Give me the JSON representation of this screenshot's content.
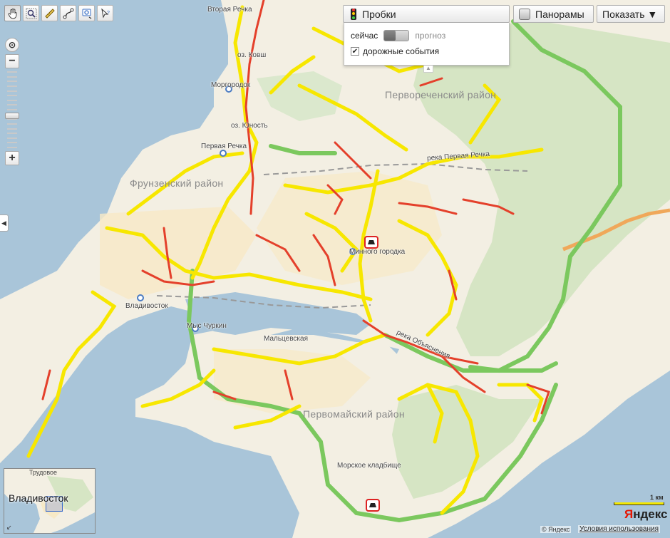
{
  "map": {
    "districts": [
      "Первореченский район",
      "Фрунзенский район",
      "Первомайский район"
    ],
    "places": [
      "Вторая Речка",
      "оз. Ковш",
      "Моргородок",
      "оз. Юность",
      "Первая Речка",
      "Минного городка",
      "Владивосток",
      "Мыс Чуркин",
      "Мальцевская",
      "Морское кладбище"
    ],
    "streets": [
      "река Первая Речка",
      "река Объяснения"
    ],
    "traffic_colors": {
      "free": "#7bc85e",
      "moderate": "#f7e700",
      "heavy": "#e4402b"
    },
    "incident_icon": "car-accident-icon"
  },
  "toolbar": {
    "tools": [
      {
        "name": "hand-tool",
        "icon": "hand-icon"
      },
      {
        "name": "zoom-area-tool",
        "icon": "magnifier-icon"
      },
      {
        "name": "ruler-tool",
        "icon": "ruler-icon"
      },
      {
        "name": "route-tool",
        "icon": "route-icon"
      },
      {
        "name": "search-tool",
        "icon": "search-icon"
      },
      {
        "name": "info-tool",
        "icon": "cursor-info-icon"
      }
    ]
  },
  "zoom": {
    "level": 0.58
  },
  "traffic": {
    "button_label": "Пробки",
    "now_label": "сейчас",
    "forecast_label": "прогноз",
    "events_label": "дорожные события",
    "events_checked": true
  },
  "panoramas_label": "Панорамы",
  "show_label": "Показать ▼",
  "minimap": {
    "city": "Владивосток",
    "village": "Трудовое"
  },
  "scale": {
    "label": "1 км"
  },
  "footer": {
    "logo_first": "Я",
    "logo_rest": "ндекс",
    "copyright": "© Яндекс",
    "terms": "Условия использования"
  }
}
